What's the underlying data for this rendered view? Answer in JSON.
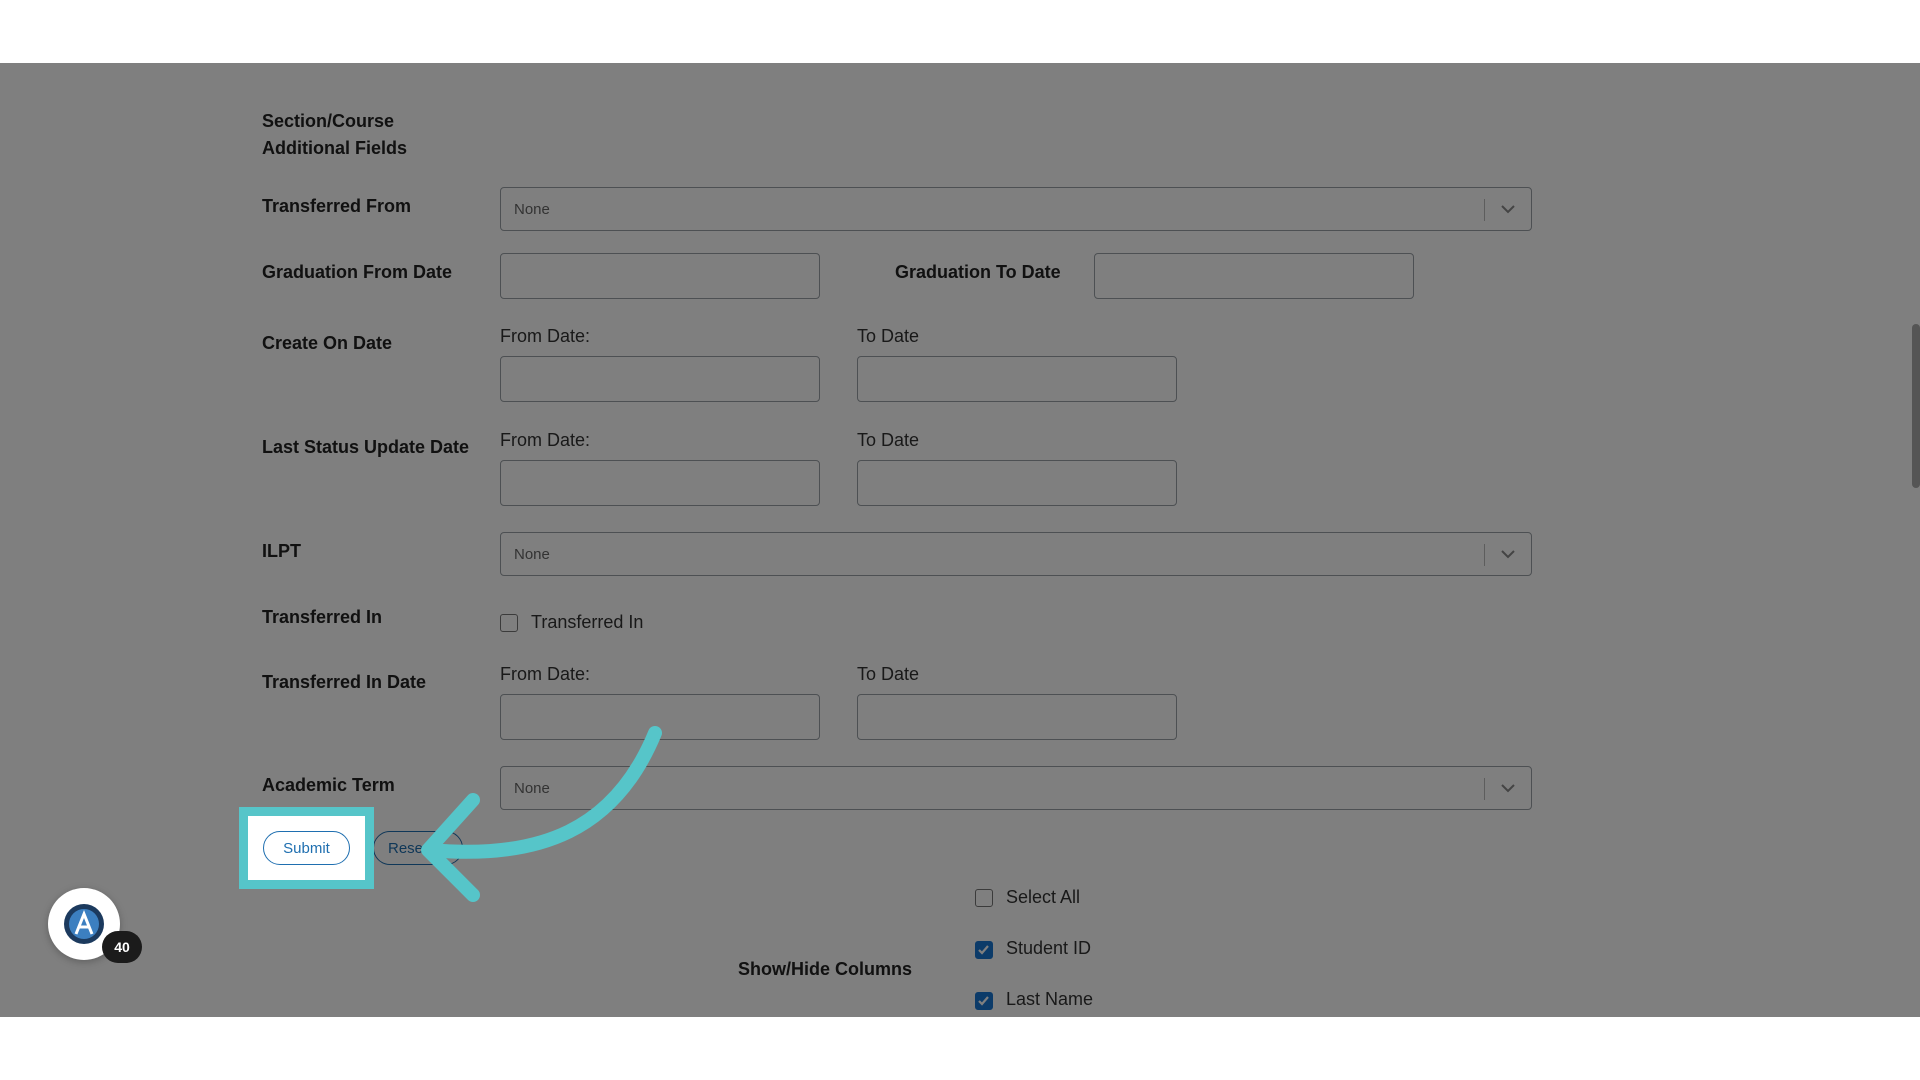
{
  "form": {
    "section_course_label_line1": "Section/Course",
    "section_course_label_line2": "Additional Fields",
    "transferred_from": {
      "label": "Transferred From",
      "value": "None"
    },
    "graduation_from_date": {
      "label": "Graduation From Date",
      "value": ""
    },
    "graduation_to_date": {
      "label": "Graduation To Date",
      "value": ""
    },
    "create_on_date": {
      "label": "Create On Date",
      "from_label": "From Date:",
      "to_label": "To Date"
    },
    "last_status_update_date": {
      "label": "Last Status Update Date",
      "from_label": "From Date:",
      "to_label": "To Date"
    },
    "ilpt": {
      "label": "ILPT",
      "value": "None"
    },
    "transferred_in": {
      "label": "Transferred In",
      "checkbox_label": "Transferred In",
      "checked": false
    },
    "transferred_in_date": {
      "label": "Transferred In Date",
      "from_label": "From Date:",
      "to_label": "To Date"
    },
    "academic_term": {
      "label": "Academic Term",
      "value": "None"
    }
  },
  "actions": {
    "submit_label": "Submit",
    "reset_label": "Rese"
  },
  "columns": {
    "label": "Show/Hide Columns",
    "options": [
      {
        "label": "Select All",
        "checked": false
      },
      {
        "label": "Student ID",
        "checked": true
      },
      {
        "label": "Last Name",
        "checked": true
      }
    ]
  },
  "badge": {
    "count": "40",
    "icon": "app-logo-icon"
  },
  "colors": {
    "highlight": "#56c5c9",
    "primary": "#1f6fb0",
    "checkbox": "#1976d2"
  }
}
